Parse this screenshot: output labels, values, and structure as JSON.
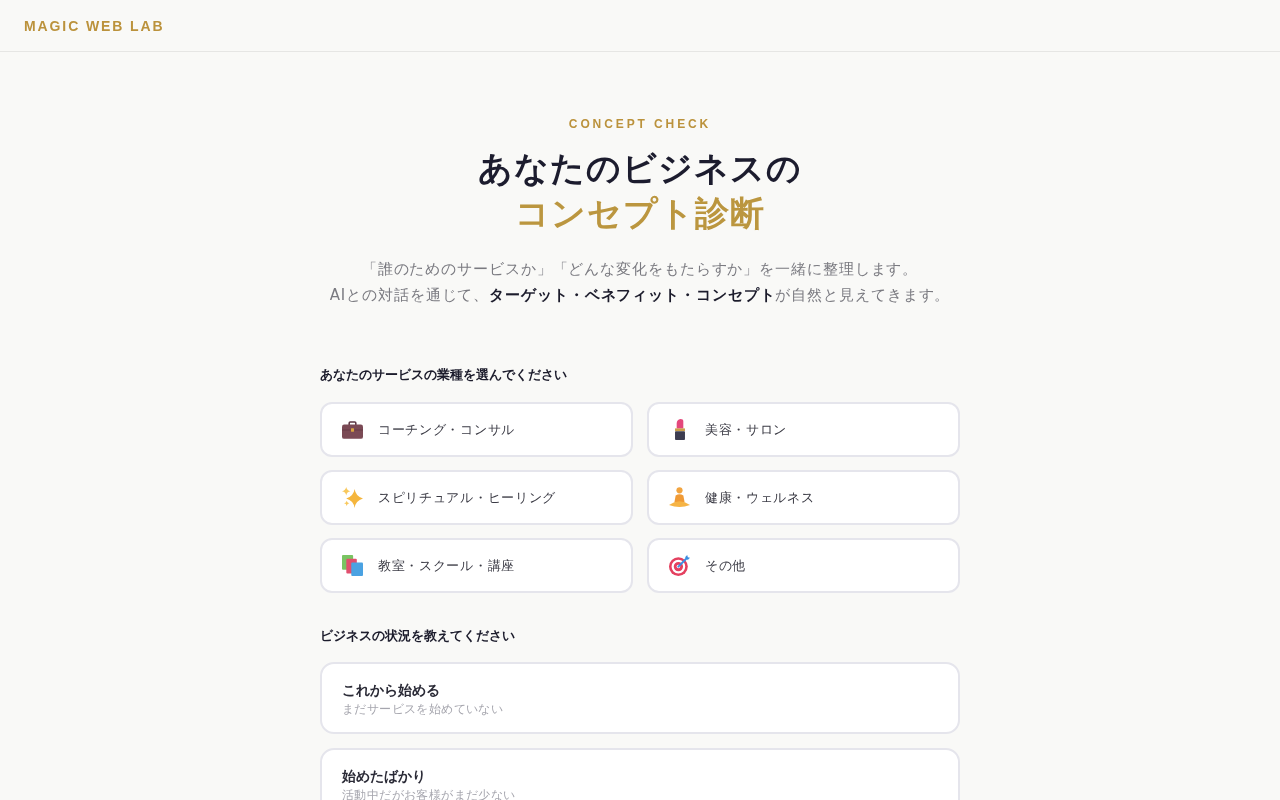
{
  "header": {
    "logo": "MAGIC WEB LAB"
  },
  "hero": {
    "eyebrow": "CONCEPT CHECK",
    "title_line_1": "あなたのビジネスの",
    "title_line_2": "コンセプト診断",
    "description_lines": [
      "「誰のためのサービスか」「どんな変化をもたらすか」を一緒に整理します。",
      "AIとの対話を通じて、**ターゲット・ベネフィット・コンセプト**が自然と見えてきます。"
    ]
  },
  "industry": {
    "label": "あなたのサービスの業種を選んでください",
    "options": [
      {
        "label": "コーチング・コンサル",
        "selected": false
      },
      {
        "label": "美容・サロン",
        "selected": false
      },
      {
        "label": "スピリチュアル・ヒーリング",
        "selected": false
      },
      {
        "label": "健康・ウェルネス",
        "selected": false
      },
      {
        "label": "教室・スクール・講座",
        "selected": false
      },
      {
        "label": "その他",
        "selected": false
      }
    ]
  },
  "status": {
    "label": "ビジネスの状況を教えてください",
    "options": [
      {
        "title": "これから始める",
        "description": "まだサービスを始めていない",
        "selected": false
      },
      {
        "title": "始めたばかり",
        "description": "活動中だがお客様がまだ少ない",
        "selected": false
      }
    ]
  }
}
